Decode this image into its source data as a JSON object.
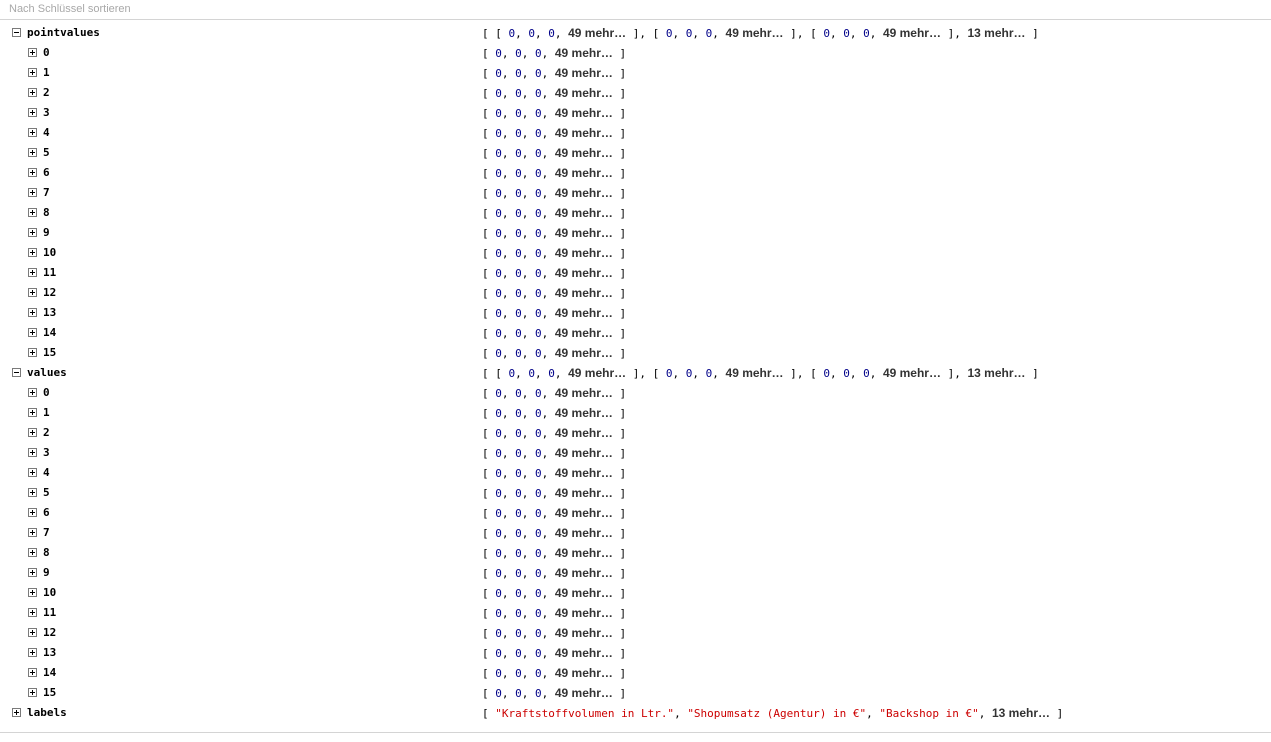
{
  "toolbar": {
    "sort_label": "Nach Schlüssel sortieren"
  },
  "sections": [
    {
      "key": "pointvalues",
      "expanded": true,
      "summary": [
        "0",
        "0",
        "0",
        "49 mehr…"
      ],
      "more": "13 mehr…",
      "items": [
        {
          "key": "0",
          "values": [
            "0",
            "0",
            "0"
          ],
          "more": "49 mehr…"
        },
        {
          "key": "1",
          "values": [
            "0",
            "0",
            "0"
          ],
          "more": "49 mehr…"
        },
        {
          "key": "2",
          "values": [
            "0",
            "0",
            "0"
          ],
          "more": "49 mehr…"
        },
        {
          "key": "3",
          "values": [
            "0",
            "0",
            "0"
          ],
          "more": "49 mehr…"
        },
        {
          "key": "4",
          "values": [
            "0",
            "0",
            "0"
          ],
          "more": "49 mehr…"
        },
        {
          "key": "5",
          "values": [
            "0",
            "0",
            "0"
          ],
          "more": "49 mehr…"
        },
        {
          "key": "6",
          "values": [
            "0",
            "0",
            "0"
          ],
          "more": "49 mehr…"
        },
        {
          "key": "7",
          "values": [
            "0",
            "0",
            "0"
          ],
          "more": "49 mehr…"
        },
        {
          "key": "8",
          "values": [
            "0",
            "0",
            "0"
          ],
          "more": "49 mehr…"
        },
        {
          "key": "9",
          "values": [
            "0",
            "0",
            "0"
          ],
          "more": "49 mehr…"
        },
        {
          "key": "10",
          "values": [
            "0",
            "0",
            "0"
          ],
          "more": "49 mehr…"
        },
        {
          "key": "11",
          "values": [
            "0",
            "0",
            "0"
          ],
          "more": "49 mehr…"
        },
        {
          "key": "12",
          "values": [
            "0",
            "0",
            "0"
          ],
          "more": "49 mehr…"
        },
        {
          "key": "13",
          "values": [
            "0",
            "0",
            "0"
          ],
          "more": "49 mehr…"
        },
        {
          "key": "14",
          "values": [
            "0",
            "0",
            "0"
          ],
          "more": "49 mehr…"
        },
        {
          "key": "15",
          "values": [
            "0",
            "0",
            "0"
          ],
          "more": "49 mehr…"
        }
      ]
    },
    {
      "key": "values",
      "expanded": true,
      "summary": [
        "0",
        "0",
        "0",
        "49 mehr…"
      ],
      "more": "13 mehr…",
      "items": [
        {
          "key": "0",
          "values": [
            "0",
            "0",
            "0"
          ],
          "more": "49 mehr…"
        },
        {
          "key": "1",
          "values": [
            "0",
            "0",
            "0"
          ],
          "more": "49 mehr…"
        },
        {
          "key": "2",
          "values": [
            "0",
            "0",
            "0"
          ],
          "more": "49 mehr…"
        },
        {
          "key": "3",
          "values": [
            "0",
            "0",
            "0"
          ],
          "more": "49 mehr…"
        },
        {
          "key": "4",
          "values": [
            "0",
            "0",
            "0"
          ],
          "more": "49 mehr…"
        },
        {
          "key": "5",
          "values": [
            "0",
            "0",
            "0"
          ],
          "more": "49 mehr…"
        },
        {
          "key": "6",
          "values": [
            "0",
            "0",
            "0"
          ],
          "more": "49 mehr…"
        },
        {
          "key": "7",
          "values": [
            "0",
            "0",
            "0"
          ],
          "more": "49 mehr…"
        },
        {
          "key": "8",
          "values": [
            "0",
            "0",
            "0"
          ],
          "more": "49 mehr…"
        },
        {
          "key": "9",
          "values": [
            "0",
            "0",
            "0"
          ],
          "more": "49 mehr…"
        },
        {
          "key": "10",
          "values": [
            "0",
            "0",
            "0"
          ],
          "more": "49 mehr…"
        },
        {
          "key": "11",
          "values": [
            "0",
            "0",
            "0"
          ],
          "more": "49 mehr…"
        },
        {
          "key": "12",
          "values": [
            "0",
            "0",
            "0"
          ],
          "more": "49 mehr…"
        },
        {
          "key": "13",
          "values": [
            "0",
            "0",
            "0"
          ],
          "more": "49 mehr…"
        },
        {
          "key": "14",
          "values": [
            "0",
            "0",
            "0"
          ],
          "more": "49 mehr…"
        },
        {
          "key": "15",
          "values": [
            "0",
            "0",
            "0"
          ],
          "more": "49 mehr…"
        }
      ]
    },
    {
      "key": "labels",
      "expanded": false,
      "strings": [
        "\"Kraftstoffvolumen in Ltr.\"",
        "\"Shopumsatz (Agentur) in €\"",
        "\"Backshop in €\""
      ],
      "more": "13 mehr…",
      "items": []
    }
  ],
  "colors": {
    "number": "#000088",
    "string": "#cc0000"
  },
  "icons": {
    "expanded": "minus-box-icon",
    "collapsed": "plus-box-icon"
  }
}
